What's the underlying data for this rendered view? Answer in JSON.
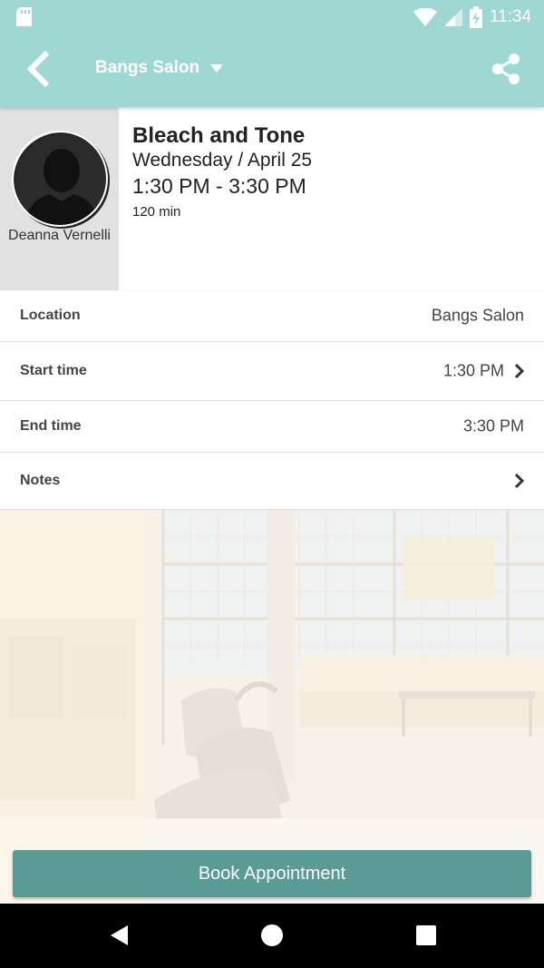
{
  "status_bar": {
    "time": "11:34",
    "icons": [
      "sd-card-icon",
      "wifi-icon",
      "signal-icon",
      "battery-charging-icon"
    ]
  },
  "app_bar": {
    "title": "Bangs Salon",
    "back_icon": "back-chevron-icon",
    "dropdown_icon": "caret-down-icon",
    "share_icon": "share-icon"
  },
  "appointment": {
    "staff_name": "Deanna Vernelli",
    "service": "Bleach and Tone",
    "date": "Wednesday / April 25",
    "time_range": "1:30 PM - 3:30 PM",
    "duration": "120 min"
  },
  "details": {
    "location": {
      "label": "Location",
      "value": "Bangs Salon"
    },
    "start_time": {
      "label": "Start time",
      "value": "1:30 PM"
    },
    "end_time": {
      "label": "End time",
      "value": "3:30 PM"
    },
    "notes": {
      "label": "Notes"
    }
  },
  "book_button": {
    "label": "Book Appointment"
  },
  "colors": {
    "appbar": "#9fd8d3",
    "book_button": "#5b9b95",
    "staff_box": "#e1e1e1",
    "navbar": "#000000"
  }
}
